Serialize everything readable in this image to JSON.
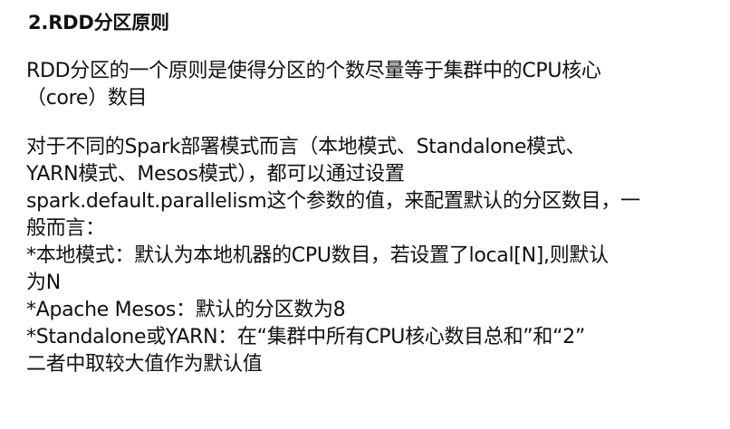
{
  "slide": {
    "title": "2.RDD分区原则",
    "paragraph1": [
      "RDD分区的一个原则是使得分区的个数尽量等于集群中的CPU核心",
      "（core）数目"
    ],
    "paragraph2": [
      "对于不同的Spark部署模式而言（本地模式、Standalone模式、",
      "YARN模式、Mesos模式），都可以通过设置",
      "spark.default.parallelism这个参数的值，来配置默认的分区数目，一",
      "般而言：",
      "*本地模式：默认为本地机器的CPU数目，若设置了local[N],则默认",
      "为N",
      "*Apache Mesos：默认的分区数为8",
      "*Standalone或YARN：在“集群中所有CPU核心数目总和”和“2”",
      "二者中取较大值作为默认值"
    ]
  }
}
